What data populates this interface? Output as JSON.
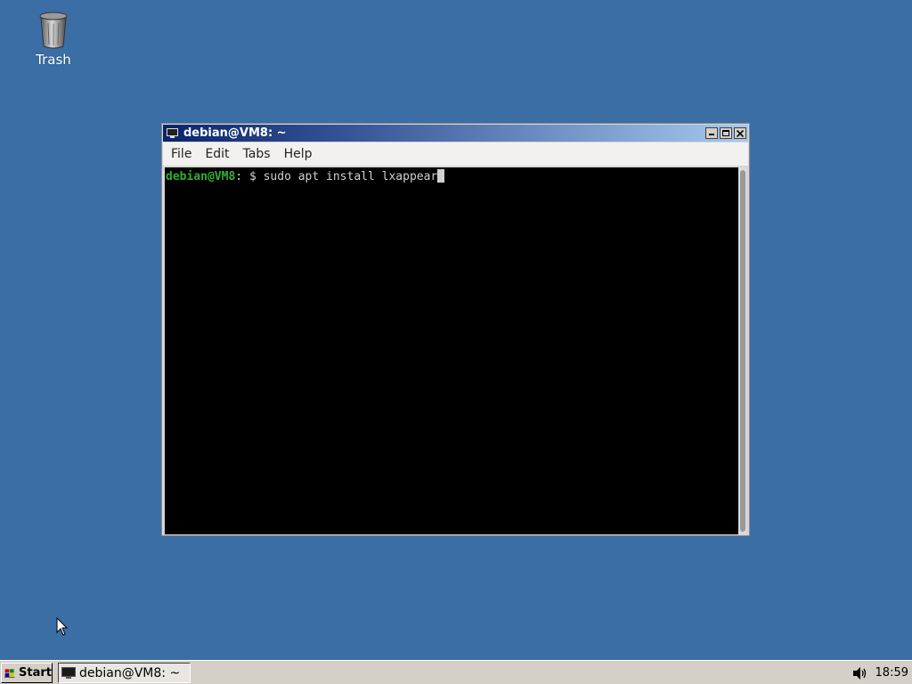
{
  "desktop": {
    "icons": [
      {
        "label": "Trash",
        "icon": "trash-icon"
      }
    ],
    "background_color": "#3a6ea5"
  },
  "window": {
    "title": "debian@VM8: ~",
    "icon": "terminal-icon",
    "controls": [
      "minimize-icon",
      "maximize-icon",
      "close-icon"
    ],
    "menu": [
      "File",
      "Edit",
      "Tabs",
      "Help"
    ],
    "terminal": {
      "prompt_user": "debian@VM8",
      "prompt_sep": ": ",
      "prompt_symbol": "$ ",
      "command": "sudo apt install lxappear"
    }
  },
  "taskbar": {
    "start_label": "Start",
    "tasks": [
      {
        "label": "debian@VM8: ~",
        "icon": "terminal-icon"
      }
    ],
    "clock": "18:59",
    "tray_icons": [
      "volume-icon"
    ]
  }
}
